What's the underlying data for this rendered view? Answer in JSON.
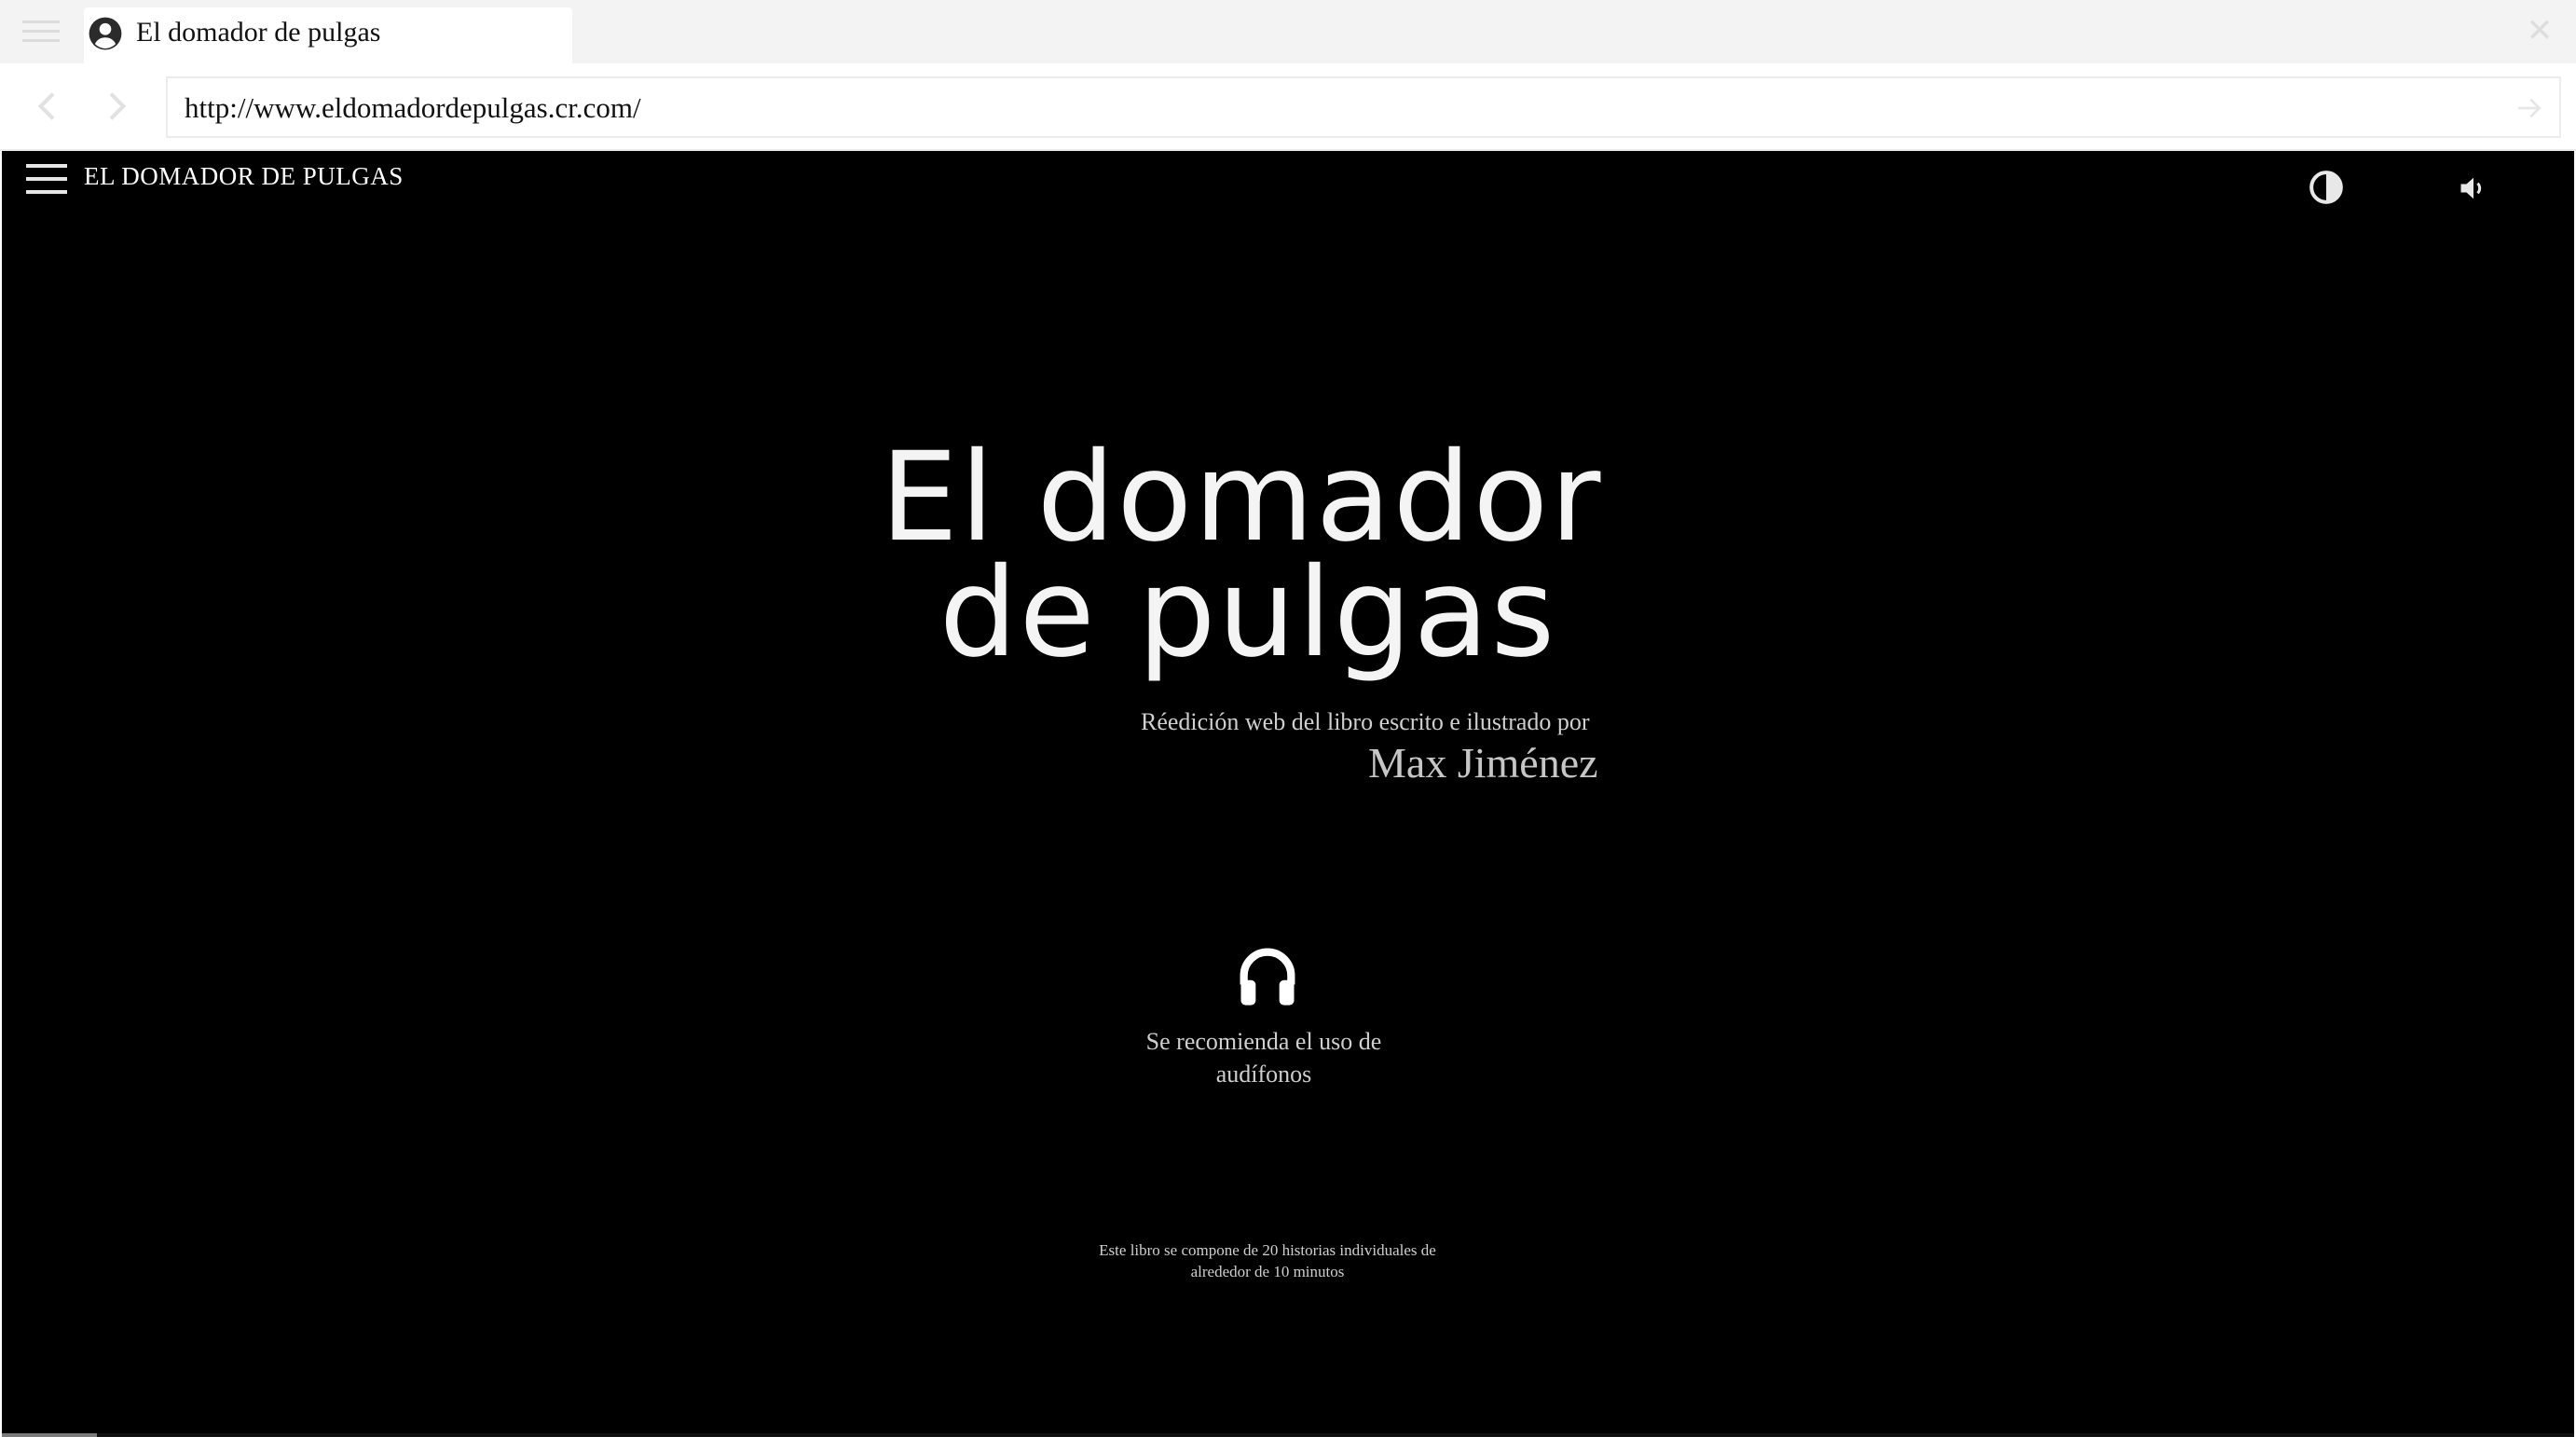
{
  "browser": {
    "tab_title": "El domador de pulgas",
    "url": "http://www.eldomadordepulgas.cr.com/",
    "icons": {
      "menu": "menu-icon",
      "profile": "account-circle-icon",
      "close": "close-icon",
      "back": "chevron-left-icon",
      "forward": "chevron-right-icon",
      "go": "arrow-right-icon"
    },
    "close_glyph": "✕"
  },
  "site": {
    "header_title": "EL DOMADOR DE PULGAS",
    "icons": {
      "menu": "hamburger-menu-icon",
      "contrast": "contrast-icon",
      "sound": "volume-icon"
    }
  },
  "hero": {
    "title_line1": "El domador",
    "title_line2": "de pulgas",
    "subtitle": "Réedición web del libro escrito e ilustrado por",
    "author": "Max Jiménez"
  },
  "notice": {
    "icon": "headphones-icon",
    "line1": "Se recomienda el uso de",
    "line2": "audífonos"
  },
  "footnote": {
    "line1": "Este libro se compone de 20 historias individuales de",
    "line2": "alrededor de 10 minutos"
  },
  "progress": {
    "fraction": 0.037
  },
  "colors": {
    "page_background": "#000000",
    "title_text": "#f4f4f4",
    "body_text": "#cfcfcf",
    "chrome_background": "#f3f3f3"
  }
}
